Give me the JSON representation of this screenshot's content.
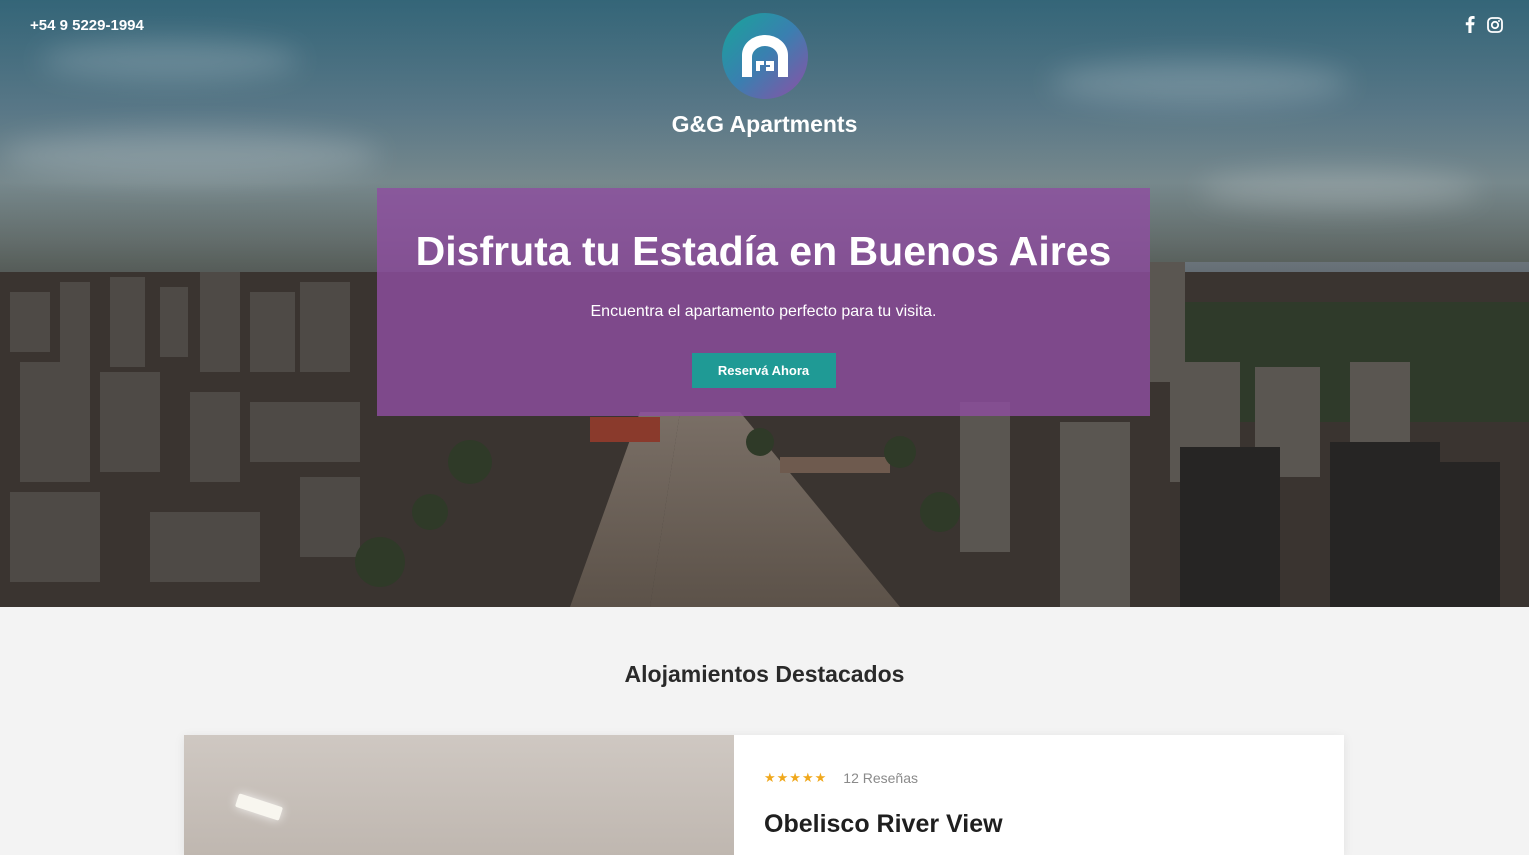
{
  "header": {
    "phone": "+54 9 5229-1994",
    "brand_name": "G&G Apartments",
    "logo_icon": "gg-logo-icon",
    "social": [
      {
        "name": "facebook-icon"
      },
      {
        "name": "instagram-icon"
      }
    ]
  },
  "hero": {
    "title": "Disfruta tu Estadía en Buenos Aires",
    "subtitle": "Encuentra el apartamento perfecto para tu visita.",
    "cta_label": "Reservá Ahora",
    "overlay_color": "#8e4ea0",
    "cta_color": "#1f9a95"
  },
  "featured": {
    "section_title": "Alojamientos Destacados",
    "cards": [
      {
        "stars": "★★★★★",
        "reviews": "12 Reseñas",
        "title": "Obelisco River View"
      }
    ]
  },
  "colors": {
    "star": "#f0a81c",
    "page_bg": "#f3f3f3"
  }
}
